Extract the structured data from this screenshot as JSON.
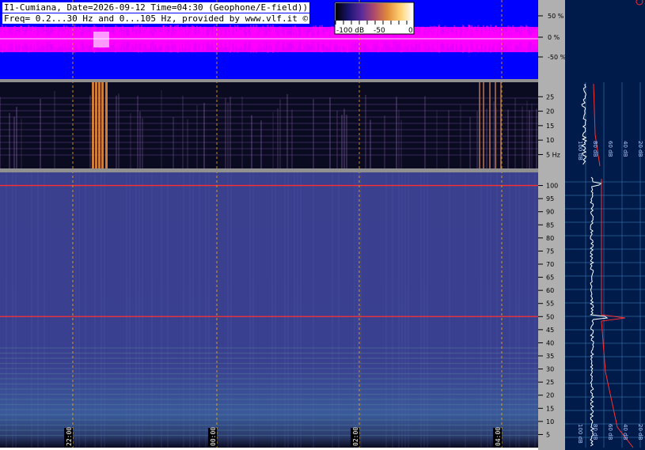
{
  "header": {
    "line1": "I1-Cumiana, Date=2026-09-12 Time=04:30 (Geophone/E-field))",
    "line2": "Freq= 0.2...30 Hz and 0...105 Hz, provided by www.vlf.it ©"
  },
  "colorbar": {
    "labels": [
      "-100 dB",
      "-50",
      "0"
    ],
    "colors": [
      "#000000",
      "#1a1470",
      "#5a2a9a",
      "#b04a6a",
      "#e08a3a",
      "#ffd070",
      "#ffffff"
    ]
  },
  "colors": {
    "waveform_bg": "#0000ff",
    "waveform_trace": "#ff00ff",
    "spectrogram_low_bg": "#0a0a20",
    "spectrogram_high_bg": "#3a3f8e",
    "side_panel_bg": "#001a4a",
    "grid_line": "#ffb000",
    "axis_panel_bg": "#b0b0b0",
    "line_50hz": "#ff3030",
    "line_100hz": "#ff3030"
  },
  "time_axis": {
    "ticks": [
      "22:00",
      "00:00",
      "02:00",
      "04:00"
    ]
  },
  "chart_data": [
    {
      "type": "line",
      "title": "",
      "ylabel": "",
      "y_ticks": [
        "50 %",
        "0 %",
        "-50 %"
      ],
      "ylim": [
        -100,
        100
      ]
    },
    {
      "type": "heatmap",
      "title": "",
      "ylabel": "",
      "y_ticks": [
        "25",
        "20",
        "15",
        "10",
        "5 Hz"
      ],
      "y_tick_values": [
        25,
        20,
        15,
        10,
        5
      ],
      "ylim": [
        0.2,
        30
      ],
      "bright_bands_hours": [
        22.3,
        4.1
      ]
    },
    {
      "type": "heatmap",
      "title": "",
      "ylabel": "",
      "y_ticks": [
        "100",
        "95",
        "90",
        "85",
        "80",
        "75",
        "70",
        "65",
        "60",
        "55",
        "50",
        "45",
        "40",
        "35",
        "30",
        "25",
        "20",
        "15",
        "10",
        "5"
      ],
      "y_tick_values": [
        100,
        95,
        90,
        85,
        80,
        75,
        70,
        65,
        60,
        55,
        50,
        45,
        40,
        35,
        30,
        25,
        20,
        15,
        10,
        5
      ],
      "ylim": [
        0,
        105
      ],
      "lines_hz": [
        50,
        100
      ]
    },
    {
      "type": "line",
      "title": "",
      "x_ticks": [
        "100 dB",
        "80 dB",
        "60 dB",
        "40 dB",
        "20 dB"
      ],
      "x_tick_values": [
        100,
        80,
        60,
        40,
        20
      ]
    }
  ]
}
